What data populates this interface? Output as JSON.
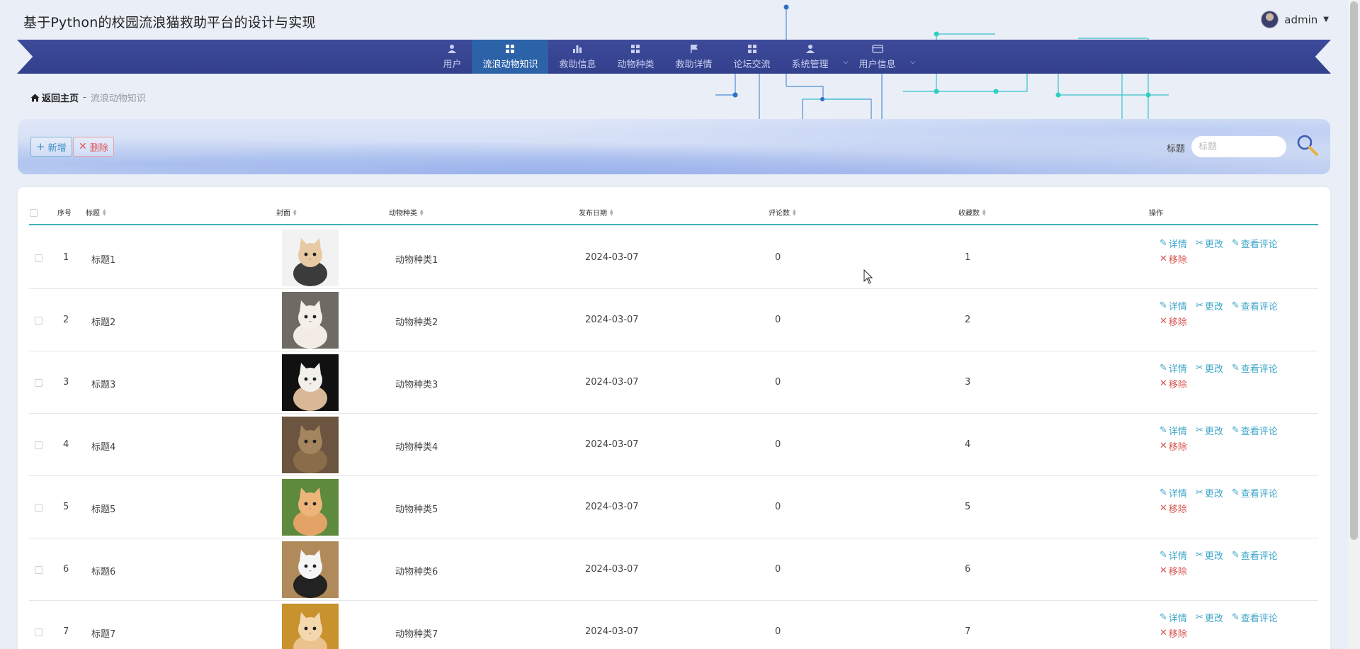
{
  "site_title": "基于Python的校园流浪猫救助平台的设计与实现",
  "user": {
    "name": "admin"
  },
  "nav": {
    "items": [
      {
        "label": "用户",
        "icon": "user-icon"
      },
      {
        "label": "流浪动物知识",
        "icon": "grid-icon",
        "active": true
      },
      {
        "label": "救助信息",
        "icon": "bar-chart-icon"
      },
      {
        "label": "动物种类",
        "icon": "grid-icon"
      },
      {
        "label": "救助详情",
        "icon": "flag-icon"
      },
      {
        "label": "论坛交流",
        "icon": "grid-icon"
      },
      {
        "label": "系统管理",
        "icon": "user-icon",
        "dropdown": true
      },
      {
        "label": "用户信息",
        "icon": "card-icon",
        "dropdown": true
      }
    ]
  },
  "breadcrumb": {
    "home": "返回主页",
    "separator": "-",
    "current": "流浪动物知识"
  },
  "toolbar": {
    "add_label": "新增",
    "delete_label": "删除"
  },
  "search": {
    "label": "标题",
    "placeholder": "标题"
  },
  "table": {
    "columns": [
      "序号",
      "标题",
      "封面",
      "动物种类",
      "发布日期",
      "评论数",
      "收藏数",
      "操作"
    ],
    "rows": [
      {
        "index": "1",
        "title": "标题1",
        "cover": "cat-photo-1",
        "kind": "动物种类1",
        "date": "2024-03-07",
        "comments": "0",
        "favorites": "1"
      },
      {
        "index": "2",
        "title": "标题2",
        "cover": "cat-photo-2",
        "kind": "动物种类2",
        "date": "2024-03-07",
        "comments": "0",
        "favorites": "2"
      },
      {
        "index": "3",
        "title": "标题3",
        "cover": "cat-photo-3",
        "kind": "动物种类3",
        "date": "2024-03-07",
        "comments": "0",
        "favorites": "3"
      },
      {
        "index": "4",
        "title": "标题4",
        "cover": "cat-photo-4",
        "kind": "动物种类4",
        "date": "2024-03-07",
        "comments": "0",
        "favorites": "4"
      },
      {
        "index": "5",
        "title": "标题5",
        "cover": "cat-photo-5",
        "kind": "动物种类5",
        "date": "2024-03-07",
        "comments": "0",
        "favorites": "5"
      },
      {
        "index": "6",
        "title": "标题6",
        "cover": "cat-photo-6",
        "kind": "动物种类6",
        "date": "2024-03-07",
        "comments": "0",
        "favorites": "6"
      },
      {
        "index": "7",
        "title": "标题7",
        "cover": "cat-photo-7",
        "kind": "动物种类7",
        "date": "2024-03-07",
        "comments": "0",
        "favorites": "7"
      }
    ],
    "actions": {
      "detail": "详情",
      "edit": "更改",
      "comments": "查看评论",
      "remove": "移除"
    }
  },
  "colors": {
    "nav_bg": "#3d4a9a",
    "nav_active": "#2c62a8",
    "accent_teal": "#3fb3b0",
    "link_blue": "#3fa6c9",
    "danger_red": "#d9534f"
  }
}
